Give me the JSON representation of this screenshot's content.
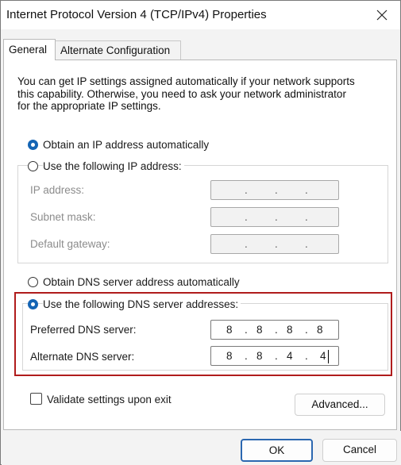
{
  "window": {
    "title": "Internet Protocol Version 4 (TCP/IPv4) Properties"
  },
  "tabs": [
    {
      "label": "General",
      "selected": true
    },
    {
      "label": "Alternate Configuration",
      "selected": false
    }
  ],
  "intro": {
    "lines": [
      "You can get IP settings assigned automatically if your network supports",
      "this capability. Otherwise, you need to ask your network administrator",
      "for the appropriate IP settings."
    ]
  },
  "ip_settings": {
    "auto_label": "Obtain an IP address automatically",
    "auto_selected": true,
    "manual_label": "Use the following IP address:",
    "manual_selected": false,
    "fields": [
      {
        "label": "IP address:",
        "value": ". . ."
      },
      {
        "label": "Subnet mask:",
        "value": ". . ."
      },
      {
        "label": "Default gateway:",
        "value": ". . ."
      }
    ]
  },
  "dns_settings": {
    "auto_label": "Obtain DNS server address automatically",
    "auto_selected": false,
    "manual_label": "Use the following DNS server addresses:",
    "manual_selected": true,
    "preferred": {
      "label": "Preferred DNS server:",
      "octets": [
        "8",
        "8",
        "8",
        "8"
      ]
    },
    "alternate": {
      "label": "Alternate DNS server:",
      "octets": [
        "8",
        "8",
        "4",
        "4"
      ]
    }
  },
  "validate": {
    "label": "Validate settings upon exit",
    "checked": false
  },
  "buttons": {
    "advanced": "Advanced...",
    "ok": "OK",
    "cancel": "Cancel"
  },
  "colors": {
    "accent": "#1464b4",
    "highlight_border": "#b01c1c"
  }
}
